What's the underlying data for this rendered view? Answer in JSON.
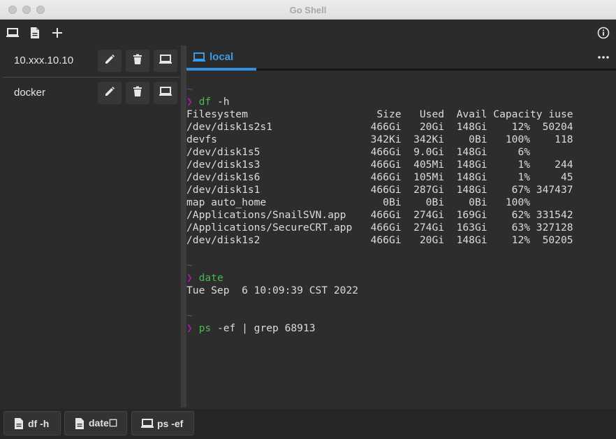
{
  "window": {
    "title": "Go Shell"
  },
  "toolbar": {
    "icons": [
      "laptop-icon",
      "document-icon",
      "plus-icon"
    ],
    "info_icon": "info-icon"
  },
  "sidebar": {
    "hosts": [
      {
        "name": "10.xxx.10.10"
      },
      {
        "name": "docker"
      }
    ]
  },
  "tabs": [
    {
      "label": "local",
      "icon": "laptop-icon",
      "active": true
    }
  ],
  "terminal": {
    "lines": [
      {
        "type": "tilde",
        "text": "~"
      },
      {
        "type": "cmd",
        "prompt": "❯",
        "cmd": "df",
        "args": " -h"
      },
      {
        "type": "out",
        "text": "Filesystem                     Size   Used  Avail Capacity iuse"
      },
      {
        "type": "out",
        "text": "/dev/disk1s2s1                466Gi   20Gi  148Gi    12%  50204"
      },
      {
        "type": "out",
        "text": "devfs                         342Ki  342Ki    0Bi   100%    118"
      },
      {
        "type": "out",
        "text": "/dev/disk1s5                  466Gi  9.0Gi  148Gi     6%"
      },
      {
        "type": "out",
        "text": "/dev/disk1s3                  466Gi  405Mi  148Gi     1%    244"
      },
      {
        "type": "out",
        "text": "/dev/disk1s6                  466Gi  105Mi  148Gi     1%     45"
      },
      {
        "type": "out",
        "text": "/dev/disk1s1                  466Gi  287Gi  148Gi    67% 347437"
      },
      {
        "type": "out",
        "text": "map auto_home                   0Bi    0Bi    0Bi   100%"
      },
      {
        "type": "out",
        "text": "/Applications/SnailSVN.app    466Gi  274Gi  169Gi    62% 331542"
      },
      {
        "type": "out",
        "text": "/Applications/SecureCRT.app   466Gi  274Gi  163Gi    63% 327128"
      },
      {
        "type": "out",
        "text": "/dev/disk1s2                  466Gi   20Gi  148Gi    12%  50205"
      },
      {
        "type": "blank",
        "text": ""
      },
      {
        "type": "tilde",
        "text": "~"
      },
      {
        "type": "cmd",
        "prompt": "❯",
        "cmd": "date",
        "args": ""
      },
      {
        "type": "out",
        "text": "Tue Sep  6 10:09:39 CST 2022"
      },
      {
        "type": "blank",
        "text": ""
      },
      {
        "type": "tilde",
        "text": "~"
      },
      {
        "type": "cmd",
        "prompt": "❯",
        "cmd": "ps",
        "args": " -ef | grep 68913"
      }
    ]
  },
  "bottombar": {
    "buttons": [
      {
        "label": "df -h",
        "icon": "document-icon"
      },
      {
        "label": "date☐",
        "icon": "document-icon"
      },
      {
        "label": "ps -ef",
        "icon": "laptop-icon"
      }
    ]
  },
  "colors": {
    "accent": "#3b9be8",
    "prompt": "#a020a0",
    "command": "#4cb84c",
    "tilde": "#5a4aa8",
    "background": "#2d2d2d"
  }
}
